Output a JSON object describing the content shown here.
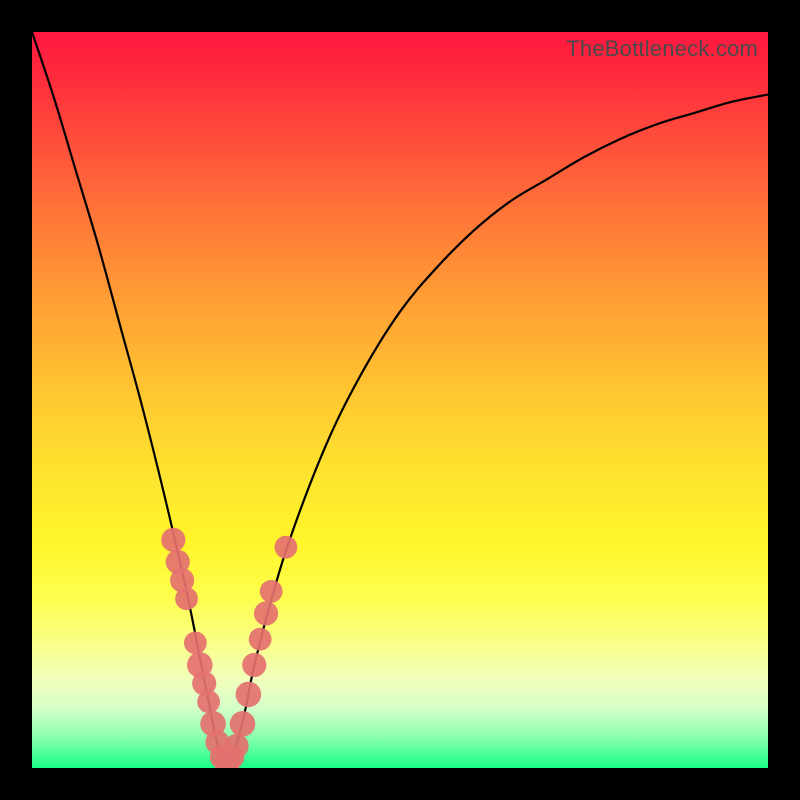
{
  "watermark_text": "TheBottleneck.com",
  "colors": {
    "frame": "#000000",
    "curve": "#000000",
    "marker": "#e4716f",
    "gradient_top": "#ff173f",
    "gradient_bottom": "#1bff88"
  },
  "chart_data": {
    "type": "line",
    "title": "",
    "xlabel": "",
    "ylabel": "",
    "xlim": [
      0,
      100
    ],
    "ylim": [
      0,
      100
    ],
    "grid": false,
    "note": "V-shaped bottleneck curve; y = bottleneck % (0 at minimum ~x=26). Background gradient red→green encodes same scale (top=high bottleneck).",
    "series": [
      {
        "name": "bottleneck-curve",
        "x": [
          0,
          3,
          6,
          9,
          12,
          15,
          18,
          21,
          23,
          24,
          25,
          26,
          27,
          28,
          29,
          30,
          32,
          35,
          40,
          45,
          50,
          55,
          60,
          65,
          70,
          75,
          80,
          85,
          90,
          95,
          100
        ],
        "values": [
          100,
          91,
          81,
          71,
          60,
          49,
          37,
          24,
          14,
          9,
          4,
          1,
          1,
          4,
          8,
          13,
          21,
          31,
          44,
          54,
          62,
          68,
          73,
          77,
          80,
          83,
          85.5,
          87.5,
          89,
          90.5,
          91.5
        ]
      }
    ],
    "markers": {
      "name": "highlighted-points",
      "description": "Salmon dots clustered near the V minimum on both arms",
      "points": [
        {
          "x": 19.2,
          "y": 31,
          "r": 1.3
        },
        {
          "x": 19.8,
          "y": 28,
          "r": 1.3
        },
        {
          "x": 20.4,
          "y": 25.5,
          "r": 1.3
        },
        {
          "x": 21.0,
          "y": 23,
          "r": 1.2
        },
        {
          "x": 22.2,
          "y": 17,
          "r": 1.2
        },
        {
          "x": 22.8,
          "y": 14,
          "r": 1.4
        },
        {
          "x": 23.4,
          "y": 11.5,
          "r": 1.3
        },
        {
          "x": 24.0,
          "y": 9,
          "r": 1.2
        },
        {
          "x": 24.6,
          "y": 6,
          "r": 1.4
        },
        {
          "x": 25.2,
          "y": 3.5,
          "r": 1.3
        },
        {
          "x": 25.8,
          "y": 1.5,
          "r": 1.3
        },
        {
          "x": 26.5,
          "y": 0.7,
          "r": 1.4
        },
        {
          "x": 27.2,
          "y": 1.5,
          "r": 1.3
        },
        {
          "x": 27.8,
          "y": 3,
          "r": 1.3
        },
        {
          "x": 28.6,
          "y": 6,
          "r": 1.4
        },
        {
          "x": 29.4,
          "y": 10,
          "r": 1.4
        },
        {
          "x": 30.2,
          "y": 14,
          "r": 1.3
        },
        {
          "x": 31.0,
          "y": 17.5,
          "r": 1.2
        },
        {
          "x": 31.8,
          "y": 21,
          "r": 1.3
        },
        {
          "x": 32.5,
          "y": 24,
          "r": 1.2
        },
        {
          "x": 34.5,
          "y": 30,
          "r": 1.2
        }
      ]
    }
  }
}
